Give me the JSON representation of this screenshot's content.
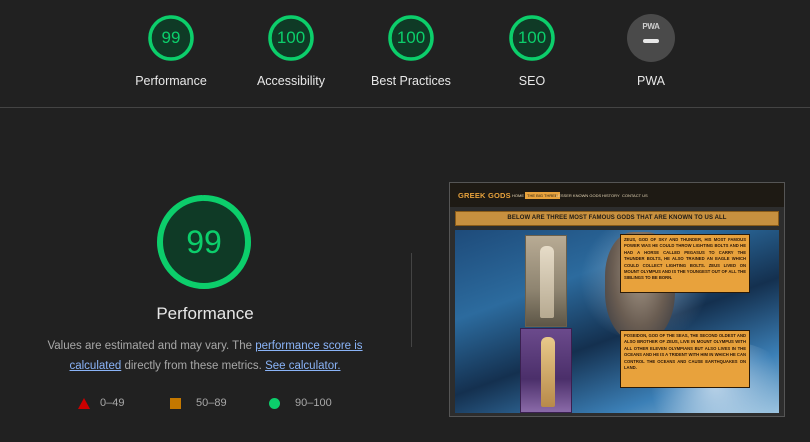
{
  "summary": {
    "categories": [
      {
        "label": "Performance",
        "score": "99"
      },
      {
        "label": "Accessibility",
        "score": "100"
      },
      {
        "label": "Best Practices",
        "score": "100"
      },
      {
        "label": "SEO",
        "score": "100"
      }
    ],
    "pwa": {
      "label": "PWA",
      "badge_text": "PWA",
      "icon": "dash-icon"
    }
  },
  "performance": {
    "score": "99",
    "score_fraction": 0.99,
    "title": "Performance",
    "desc_prefix": "Values are estimated and may vary. The ",
    "desc_link1": "performance score is calculated",
    "desc_middle": " directly from these metrics. ",
    "desc_link2": "See calculator."
  },
  "legend": {
    "fail": {
      "label": "0–49",
      "icon": "triangle-icon",
      "color": "#cc0000"
    },
    "average": {
      "label": "50–89",
      "icon": "square-icon",
      "color": "#c47800"
    },
    "pass": {
      "label": "90–100",
      "icon": "circle-icon",
      "color": "#0cce6b"
    }
  },
  "colors": {
    "background": "#212121",
    "pass_green": "#0cce6b",
    "link": "#8ab4f8",
    "thumb_accent": "#e8a23c"
  },
  "screenshot": {
    "logo": "GREEK GODS",
    "nav": [
      "HOME",
      "THE BIG THREE",
      "LESSER KNOWN GODS",
      "HISTORY",
      "CONTACT US"
    ],
    "active_nav": "THE BIG THREE",
    "banner": "BELOW ARE THREE MOST FAMOUS GODS THAT ARE KNOWN TO US ALL",
    "card1": "ZEUS, GOD OF SKY AND THUNDER, HIS MOST FAMOUS POWER WAS HE COULD THROW LIGHTING BOLTS AND HE HAD A HORSE CALLED PEGASUS TO CARRY THE THUNDER BOLTS, HE ALSO TRAINED AN EAGLE WHICH COULD COLLECT LIGHTING BOLTS. ZEUS LIVED ON MOUNT OLYMPUS AND IS THE YOUNGEST OUT OF ALL THE SIBLINGS TO BE BORN.",
    "card2": "POSEIDON, GOD OF THE SEAS, THE SECOND OLDEST AND ALSO BROTHER OF ZEUS, LIVE IN MOUNT OLYMPUS WITH ALL OTHER ELEVEN OLYMPIANS BUT ALSO LIVES IN THE OCEANS AND HE IS A TRIDENT WITH HIM IN WHICH HE CAN CONTROL THE OCEANS AND CAUSE EARTHQUAKES ON LAND."
  }
}
